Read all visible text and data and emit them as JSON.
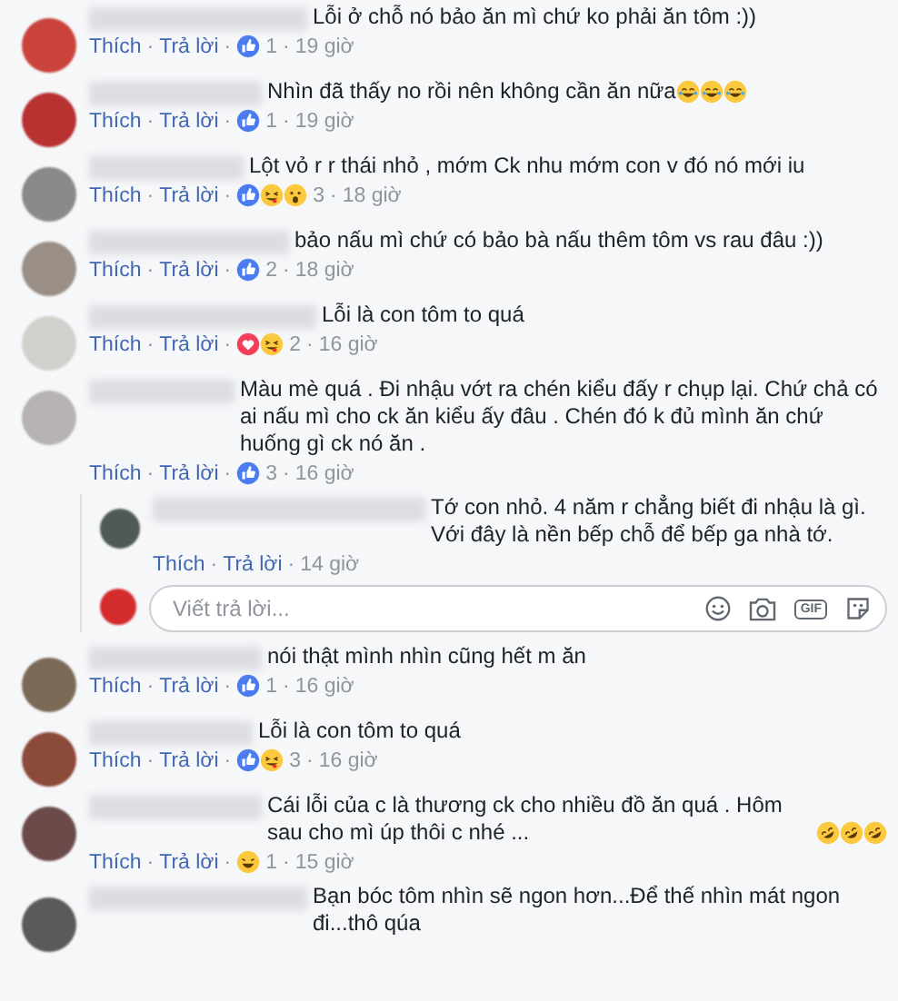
{
  "separator": "·",
  "comments": [
    {
      "text": "Lỗi ở chỗ nó bảo ăn mì chứ ko phải ăn tôm :))",
      "actions": [
        "Thích",
        "Trả lời"
      ],
      "reactions": [
        {
          "kind": "like"
        }
      ],
      "count": "1",
      "time": "19 giờ"
    },
    {
      "text": "Nhìn đã thấy no rồi nên không cần ăn nữa",
      "emoji": [
        {
          "kind": "joy"
        },
        {
          "kind": "joy"
        },
        {
          "kind": "joy"
        }
      ],
      "actions": [
        "Thích",
        "Trả lời"
      ],
      "reactions": [
        {
          "kind": "like"
        }
      ],
      "count": "1",
      "time": "19 giờ"
    },
    {
      "text": "Lột vỏ r r thái nhỏ , mớm Ck nhu mớm con v đó nó mới iu",
      "actions": [
        "Thích",
        "Trả lời"
      ],
      "reactions": [
        {
          "kind": "like"
        },
        {
          "kind": "tongue"
        },
        {
          "kind": "wow"
        }
      ],
      "count": "3",
      "time": "18 giờ"
    },
    {
      "text": "bảo nấu mì chứ có bảo bà nấu thêm tôm vs rau đâu :))",
      "actions": [
        "Thích",
        "Trả lời"
      ],
      "reactions": [
        {
          "kind": "like"
        }
      ],
      "count": "2",
      "time": "18 giờ"
    },
    {
      "text": "Lỗi là con tôm to quá",
      "actions": [
        "Thích",
        "Trả lời"
      ],
      "reactions": [
        {
          "kind": "love"
        },
        {
          "kind": "tongue"
        }
      ],
      "count": "2",
      "time": "16 giờ"
    },
    {
      "text": "Màu mè quá . Đi nhậu vớt ra chén kiểu đấy r chụp lại. Chứ chả có ai nấu mì cho ck ăn kiểu ấy đâu . Chén đó k đủ mình ăn chứ huống gì ck nó ăn .",
      "actions": [
        "Thích",
        "Trả lời"
      ],
      "reactions": [
        {
          "kind": "like"
        }
      ],
      "count": "3",
      "time": "16 giờ",
      "replies": [
        {
          "text": "Tớ con nhỏ. 4 năm r chẳng biết đi nhậu là gì. Với đây là nền bếp chỗ để bếp ga nhà tớ.",
          "actions": [
            "Thích",
            "Trả lời"
          ],
          "time": "14 giờ"
        }
      ],
      "reply_box": {
        "placeholder": "Viết trả lời...",
        "gif_label": "GIF"
      }
    },
    {
      "text": "nói thật mình nhìn cũng hết m ăn",
      "actions": [
        "Thích",
        "Trả lời"
      ],
      "reactions": [
        {
          "kind": "like"
        }
      ],
      "count": "1",
      "time": "16 giờ"
    },
    {
      "text": "Lỗi là con tôm to quá",
      "actions": [
        "Thích",
        "Trả lời"
      ],
      "reactions": [
        {
          "kind": "like"
        },
        {
          "kind": "tongue"
        }
      ],
      "count": "3",
      "time": "16 giờ"
    },
    {
      "text": "Cái lỗi của c là thương ck cho nhiều đồ ăn quá . Hôm sau cho mì úp thôi c nhé ...",
      "emoji": [
        {
          "kind": "rofl"
        },
        {
          "kind": "rofl"
        },
        {
          "kind": "rofl"
        }
      ],
      "actions": [
        "Thích",
        "Trả lời"
      ],
      "reactions": [
        {
          "kind": "grin"
        }
      ],
      "count": "1",
      "time": "15 giờ"
    },
    {
      "text": "Bạn bóc tôm nhìn sẽ ngon hơn...Để thế nhìn mát ngon đi...thô qúa"
    }
  ]
}
